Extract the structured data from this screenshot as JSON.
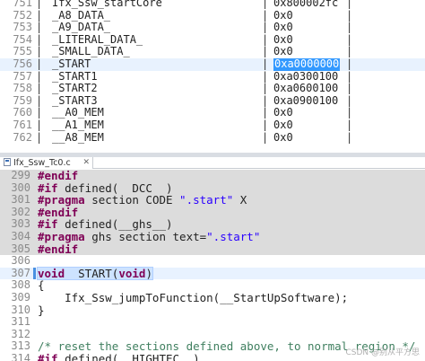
{
  "map_table": {
    "rows": [
      {
        "ln": "751",
        "name": "Ifx_Ssw_startCore",
        "addr": "0x800002fc",
        "selected": false
      },
      {
        "ln": "752",
        "name": "_A8_DATA_",
        "addr": "0x0",
        "selected": false
      },
      {
        "ln": "753",
        "name": "_A9_DATA_",
        "addr": "0x0",
        "selected": false
      },
      {
        "ln": "754",
        "name": "_LITERAL_DATA_",
        "addr": "0x0",
        "selected": false
      },
      {
        "ln": "755",
        "name": "_SMALL_DATA_",
        "addr": "0x0",
        "selected": false
      },
      {
        "ln": "756",
        "name": "_START",
        "addr": "0xa0000000",
        "selected": true
      },
      {
        "ln": "757",
        "name": "_START1",
        "addr": "0xa0300100",
        "selected": false
      },
      {
        "ln": "758",
        "name": "_START2",
        "addr": "0xa0600100",
        "selected": false
      },
      {
        "ln": "759",
        "name": "_START3",
        "addr": "0xa0900100",
        "selected": false
      },
      {
        "ln": "760",
        "name": "__A0_MEM",
        "addr": "0x0",
        "selected": false
      },
      {
        "ln": "761",
        "name": "__A1_MEM",
        "addr": "0x0",
        "selected": false
      },
      {
        "ln": "762",
        "name": "__A8_MEM",
        "addr": "0x0",
        "selected": false
      }
    ]
  },
  "editor_tab": {
    "label": "Ifx_Ssw_Tc0.c",
    "close": "✕"
  },
  "code": {
    "lines": [
      {
        "ln": "299",
        "bg": "grey",
        "tokens": [
          {
            "t": "#endif",
            "c": "kw-dir"
          }
        ]
      },
      {
        "ln": "300",
        "bg": "grey",
        "tokens": [
          {
            "t": "#if",
            "c": "kw-dir"
          },
          {
            "t": " defined(__DCC__)",
            "c": "plain"
          }
        ]
      },
      {
        "ln": "301",
        "bg": "grey",
        "tokens": [
          {
            "t": "#pragma",
            "c": "kw-dir"
          },
          {
            "t": " section CODE ",
            "c": "plain"
          },
          {
            "t": "\".start\"",
            "c": "str"
          },
          {
            "t": " X",
            "c": "plain"
          }
        ]
      },
      {
        "ln": "302",
        "bg": "grey",
        "tokens": [
          {
            "t": "#endif",
            "c": "kw-dir"
          }
        ]
      },
      {
        "ln": "303",
        "bg": "grey",
        "tokens": [
          {
            "t": "#if",
            "c": "kw-dir"
          },
          {
            "t": " defined(__ghs__)",
            "c": "plain"
          }
        ]
      },
      {
        "ln": "304",
        "bg": "grey",
        "tokens": [
          {
            "t": "#pragma",
            "c": "kw-dir"
          },
          {
            "t": " ghs section text=",
            "c": "plain"
          },
          {
            "t": "\".start\"",
            "c": "str"
          }
        ]
      },
      {
        "ln": "305",
        "bg": "grey",
        "tokens": [
          {
            "t": "#endif",
            "c": "kw-dir"
          }
        ]
      },
      {
        "ln": "306",
        "bg": "none",
        "tokens": []
      },
      {
        "ln": "307",
        "bg": "cur",
        "tokens": [
          {
            "t": "void",
            "c": "kw"
          },
          {
            "t": " _START(",
            "c": "plain"
          },
          {
            "t": "void",
            "c": "kw"
          },
          {
            "t": ")",
            "c": "plain"
          }
        ]
      },
      {
        "ln": "308",
        "bg": "none",
        "tokens": [
          {
            "t": "{",
            "c": "plain"
          }
        ]
      },
      {
        "ln": "309",
        "bg": "none",
        "tokens": [
          {
            "t": "    Ifx_Ssw_jumpToFunction(__StartUpSoftware);",
            "c": "plain"
          }
        ]
      },
      {
        "ln": "310",
        "bg": "none",
        "tokens": [
          {
            "t": "}",
            "c": "plain"
          }
        ]
      },
      {
        "ln": "311",
        "bg": "none",
        "tokens": []
      },
      {
        "ln": "312",
        "bg": "none",
        "tokens": []
      },
      {
        "ln": "313",
        "bg": "none",
        "tokens": [
          {
            "t": "/* reset the sections defined above, to normal region */",
            "c": "cmt"
          }
        ]
      },
      {
        "ln": "314",
        "bg": "none",
        "tokens": [
          {
            "t": "#if",
            "c": "kw-dir"
          },
          {
            "t": " defined(__HIGHTEC__)",
            "c": "plain"
          }
        ]
      }
    ]
  },
  "watermark": "CSDN @别从平方思"
}
